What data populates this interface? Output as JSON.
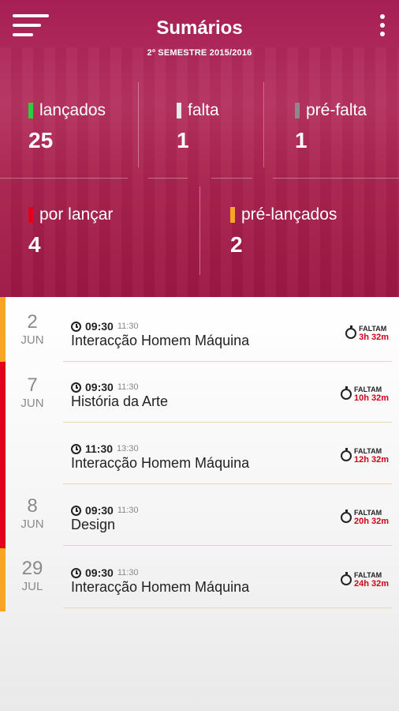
{
  "app": {
    "title": "Sumários",
    "subtitle": "2º SEMESTRE 2015/2016"
  },
  "stats": [
    {
      "label": "lançados",
      "value": "25",
      "color": "#2ecc40"
    },
    {
      "label": "falta",
      "value": "1",
      "color": "#e9e9e9"
    },
    {
      "label": "pré-falta",
      "value": "1",
      "color": "#8a8a8a"
    },
    {
      "label": "por lançar",
      "value": "4",
      "color": "#e0001b"
    },
    {
      "label": "pré-lançados",
      "value": "2",
      "color": "#f5a623"
    }
  ],
  "days": [
    {
      "day": "2",
      "month": "JUN",
      "color": "#f5a623"
    },
    {
      "day": "7",
      "month": "JUN",
      "color": "#e0001b"
    },
    {
      "day": "8",
      "month": "JUN",
      "color": "#e0001b"
    },
    {
      "day": "29",
      "month": "JUL",
      "color": "#f5a623"
    }
  ],
  "lessons": [
    {
      "start": "09:30",
      "end": "11:30",
      "subject": "Interacção Homem Máquina",
      "remain_label": "FALTAM",
      "remain": "3h 32m"
    },
    {
      "start": "09:30",
      "end": "11:30",
      "subject": "História da Arte",
      "remain_label": "FALTAM",
      "remain": "10h 32m"
    },
    {
      "start": "11:30",
      "end": "13:30",
      "subject": "Interacção Homem Máquina",
      "remain_label": "FALTAM",
      "remain": "12h 32m"
    },
    {
      "start": "09:30",
      "end": "11:30",
      "subject": "Design",
      "remain_label": "FALTAM",
      "remain": "20h 32m"
    },
    {
      "start": "09:30",
      "end": "11:30",
      "subject": "Interacção Homem Máquina",
      "remain_label": "FALTAM",
      "remain": "24h 32m"
    }
  ],
  "icons": {
    "menu": "hamburger-menu-icon",
    "more": "more-vertical-icon",
    "clock": "clock-icon",
    "timer": "stopwatch-icon"
  }
}
